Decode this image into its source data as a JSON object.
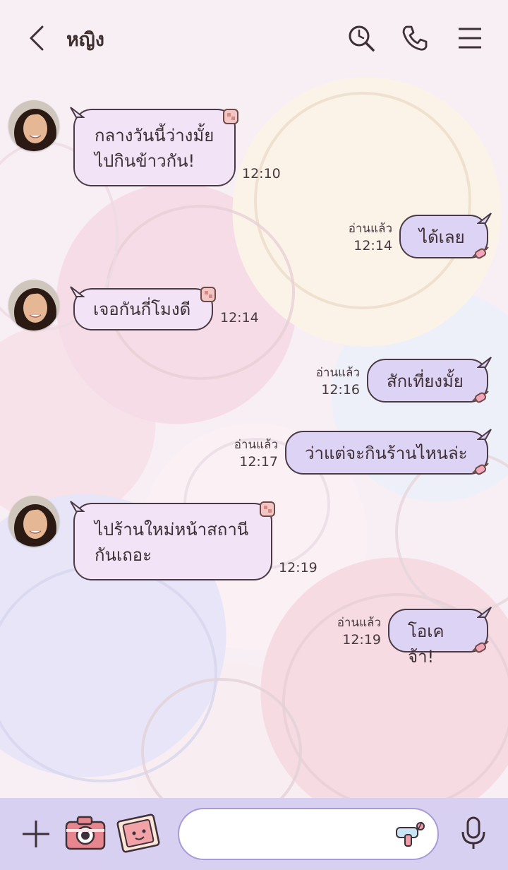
{
  "header": {
    "title": "หญิง",
    "icons": [
      "back-icon",
      "search-icon",
      "phone-icon",
      "menu-icon"
    ]
  },
  "messages": [
    {
      "side": "in",
      "lines": [
        "กลางวันนี้ว่างมั้ย",
        "ไปกินข้าวกัน!"
      ],
      "time": "12:10"
    },
    {
      "side": "out",
      "text": "ได้เลย",
      "read": "อ่านแล้ว",
      "time": "12:14"
    },
    {
      "side": "in",
      "lines": [
        "เจอกันกี่โมงดี"
      ],
      "time": "12:14"
    },
    {
      "side": "out",
      "text": "สักเที่ยงมั้ย",
      "read": "อ่านแล้ว",
      "time": "12:16"
    },
    {
      "side": "out",
      "text": "ว่าแต่จะกินร้านไหนล่ะ",
      "read": "อ่านแล้ว",
      "time": "12:17"
    },
    {
      "side": "in",
      "lines": [
        "ไปร้านใหม่หน้าสถานี",
        "กันเถอะ"
      ],
      "time": "12:19"
    },
    {
      "side": "out",
      "text": "โอเคจ้า!",
      "read": "อ่านแล้ว",
      "time": "12:19"
    }
  ],
  "bottom_bar": {
    "icons": [
      "plus-icon",
      "camera-icon",
      "sticker-icon",
      "emoji-gun-icon",
      "mic-icon"
    ],
    "input_value": ""
  },
  "colors": {
    "incoming_bubble": "#f2e3f6",
    "outgoing_bubble": "#ddd3f4",
    "bottom_bar": "#d8d0f1"
  }
}
